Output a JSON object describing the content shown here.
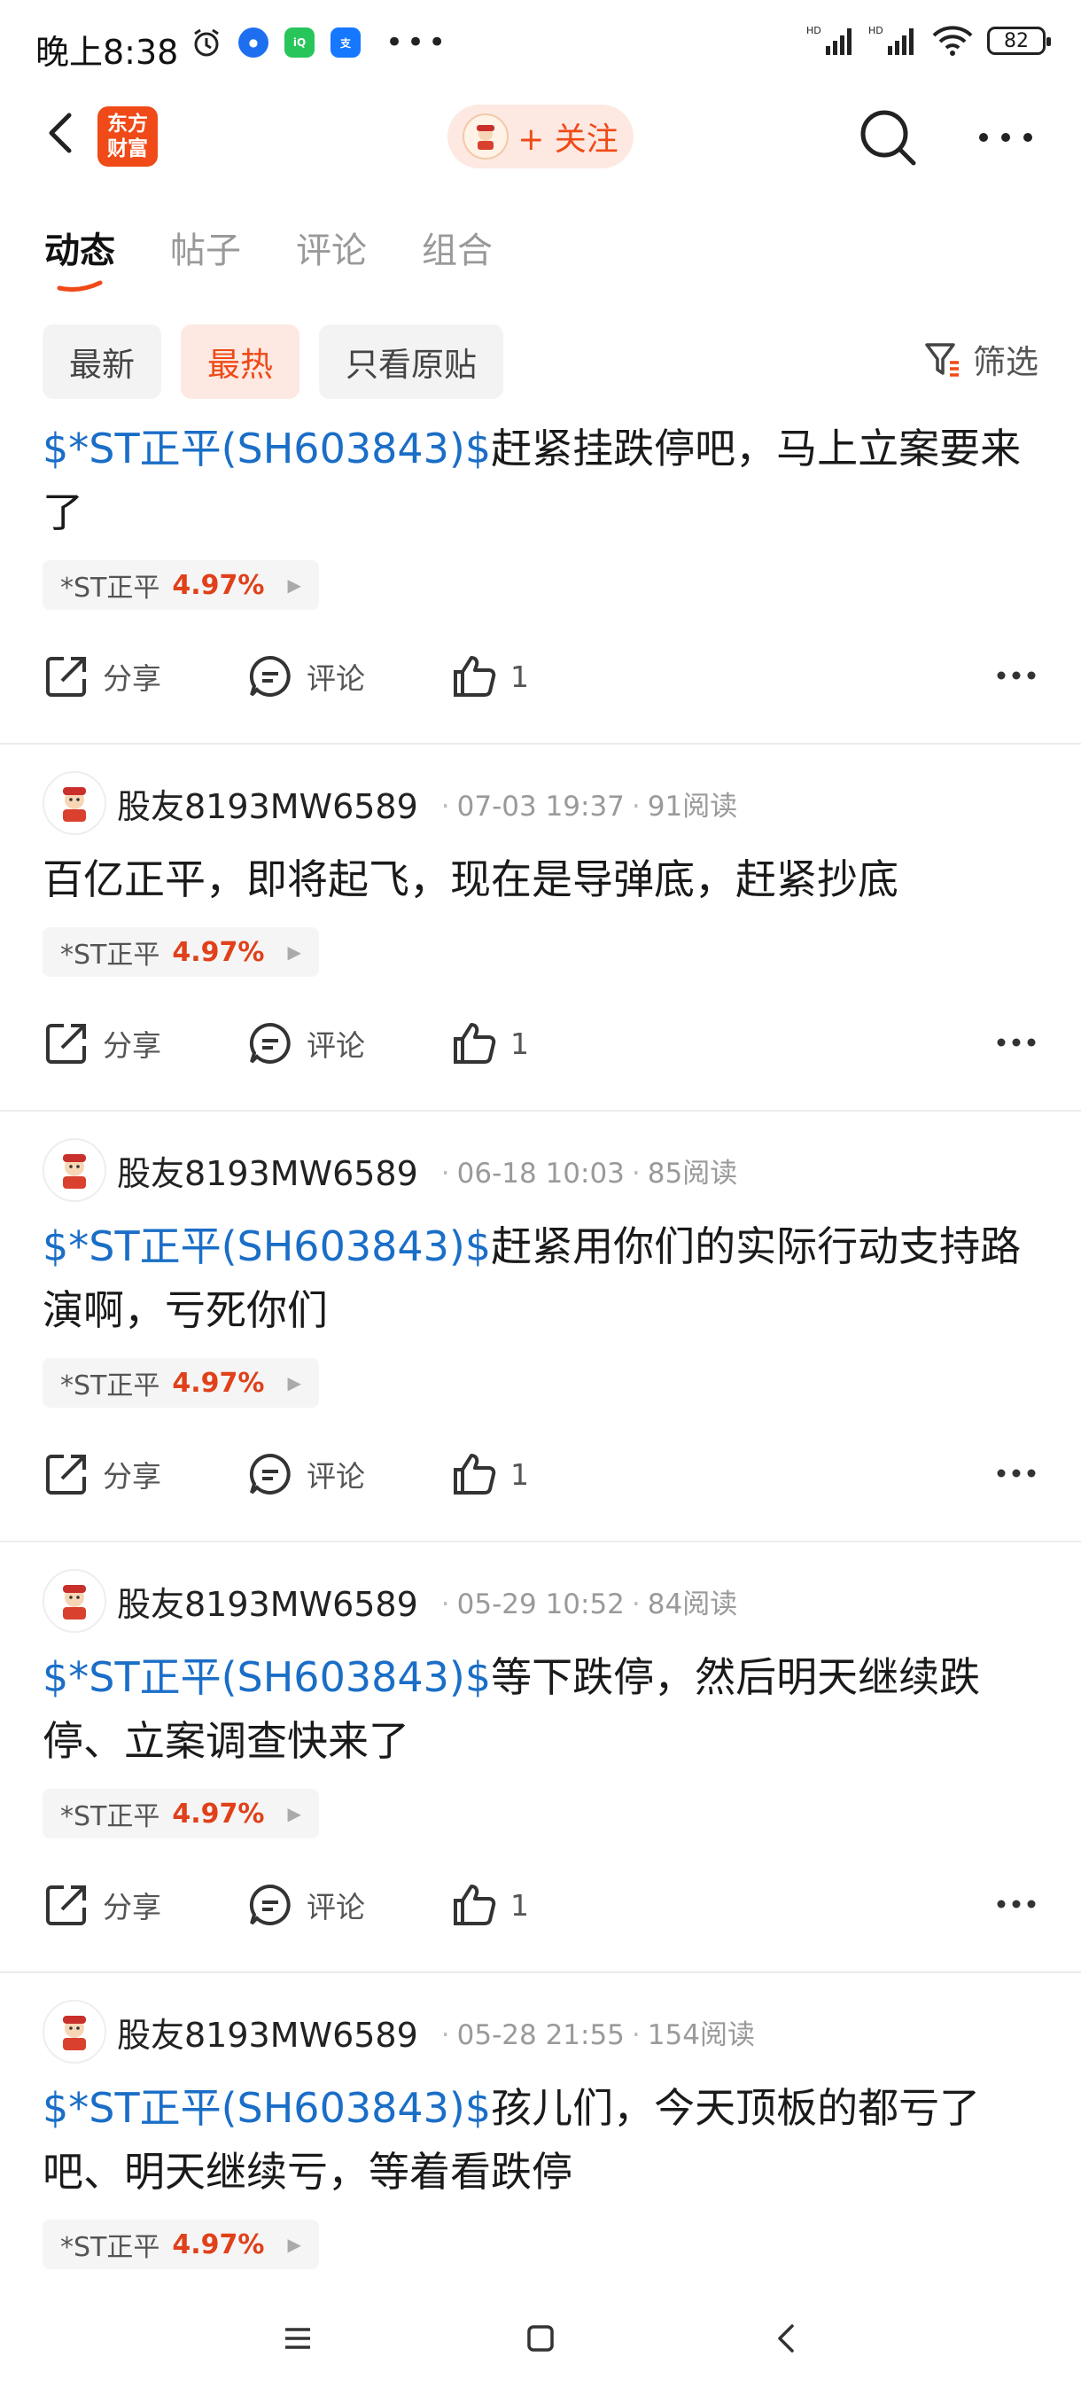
{
  "status_bar": {
    "time": "晚上8:38",
    "battery": "82"
  },
  "navbar": {
    "logo_text": "东方\n财富",
    "follow_label": "+ 关注"
  },
  "tabs": [
    {
      "label": "动态",
      "active": true
    },
    {
      "label": "帖子",
      "active": false
    },
    {
      "label": "评论",
      "active": false
    },
    {
      "label": "组合",
      "active": false
    }
  ],
  "filters": {
    "chips": [
      "最新",
      "最热",
      "只看原贴"
    ],
    "active_chip": "最热",
    "filter_label": "筛选"
  },
  "actions": {
    "share": "分享",
    "comment": "评论"
  },
  "posts": [
    {
      "username": "",
      "date": "",
      "reads": "",
      "cashtag": "$*ST正平(SH603843)$",
      "text": "赶紧挂跌停吧，马上立案要来了",
      "stock": "*ST正平",
      "change": "4.97%",
      "likes": "1"
    },
    {
      "username": "股友8193MW6589",
      "date": "07-03 19:37",
      "reads": "91阅读",
      "cashtag": "",
      "text": "百亿正平，即将起飞，现在是导弹底，赶紧抄底",
      "stock": "*ST正平",
      "change": "4.97%",
      "likes": "1"
    },
    {
      "username": "股友8193MW6589",
      "date": "06-18 10:03",
      "reads": "85阅读",
      "cashtag": "$*ST正平(SH603843)$",
      "text": "赶紧用你们的实际行动支持路演啊，亏死你们",
      "stock": "*ST正平",
      "change": "4.97%",
      "likes": "1"
    },
    {
      "username": "股友8193MW6589",
      "date": "05-29 10:52",
      "reads": "84阅读",
      "cashtag": "$*ST正平(SH603843)$",
      "text": "等下跌停，然后明天继续跌停、立案调查快来了",
      "stock": "*ST正平",
      "change": "4.97%",
      "likes": "1"
    },
    {
      "username": "股友8193MW6589",
      "date": "05-28 21:55",
      "reads": "154阅读",
      "cashtag": "$*ST正平(SH603843)$",
      "text": "孩儿们，今天顶板的都亏了吧、明天继续亏，等着看跌停",
      "stock": "*ST正平",
      "change": "4.97%",
      "likes": ""
    }
  ],
  "colors": {
    "accent": "#ef4a17",
    "link": "#1a6ec7",
    "up": "#e0401a"
  },
  "icons": [
    "back-icon",
    "search-icon",
    "more-icon",
    "filter-icon",
    "share-icon",
    "comment-icon",
    "like-icon"
  ]
}
